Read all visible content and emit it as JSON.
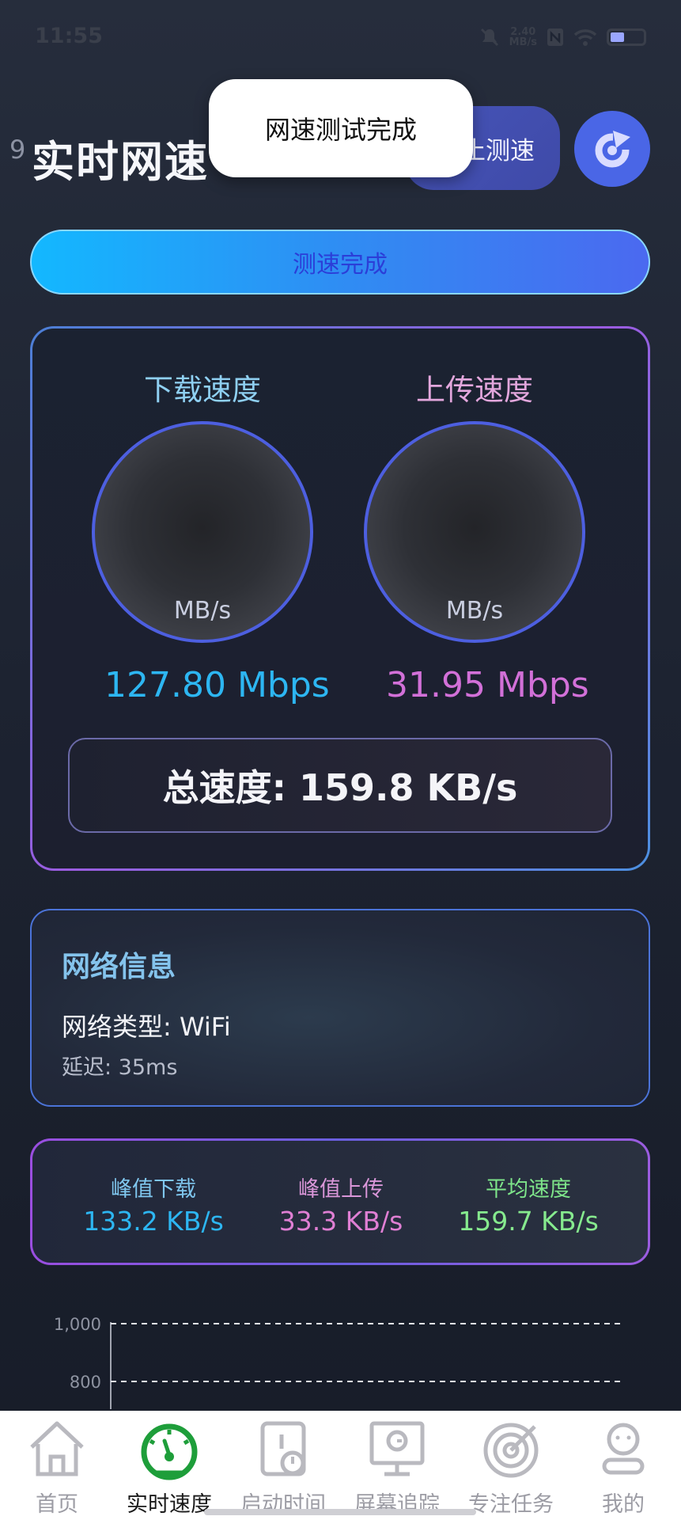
{
  "status_bar": {
    "time": "11:55",
    "net_speed_value": "2.40",
    "net_speed_unit": "MB/s"
  },
  "header": {
    "title": "实时网速",
    "partial_behind": "9",
    "stop_button_partial": "止测速",
    "refresh_icon": "refresh-icon"
  },
  "toast": {
    "text": "网速测试完成"
  },
  "status_pill": {
    "text": "测速完成"
  },
  "speed": {
    "download_label": "下载速度",
    "upload_label": "上传速度",
    "gauge_unit": "MB/s",
    "download_value": "127.80 Mbps",
    "upload_value": "31.95 Mbps",
    "total": "总速度: 159.8 KB/s"
  },
  "network_info": {
    "title": "网络信息",
    "type": "网络类型: WiFi",
    "latency": "延迟: 35ms"
  },
  "peaks": [
    {
      "label": "峰值下载",
      "value": "133.2 KB/s",
      "color": "#2db6f2"
    },
    {
      "label": "峰值上传",
      "value": "33.3 KB/s",
      "color": "#e07fd4"
    },
    {
      "label": "平均速度",
      "value": "159.7 KB/s",
      "color": "#7ee58a"
    }
  ],
  "chart_data": {
    "type": "line",
    "yticks": [
      "1,000",
      "800"
    ],
    "ylim": [
      800,
      1000
    ],
    "series": []
  },
  "tabs": [
    {
      "label": "首页",
      "icon": "home-icon"
    },
    {
      "label": "实时速度",
      "icon": "speedometer-icon",
      "active": true
    },
    {
      "label": "启动时间",
      "icon": "startup-time-icon"
    },
    {
      "label": "屏幕追踪",
      "icon": "screen-track-icon"
    },
    {
      "label": "专注任务",
      "icon": "target-icon"
    },
    {
      "label": "我的",
      "icon": "profile-icon"
    }
  ],
  "colors": {
    "accent_blue": "#4a66e6",
    "active_tab": "#1e9e3a",
    "download": "#2db6f2",
    "upload": "#d270d8"
  }
}
